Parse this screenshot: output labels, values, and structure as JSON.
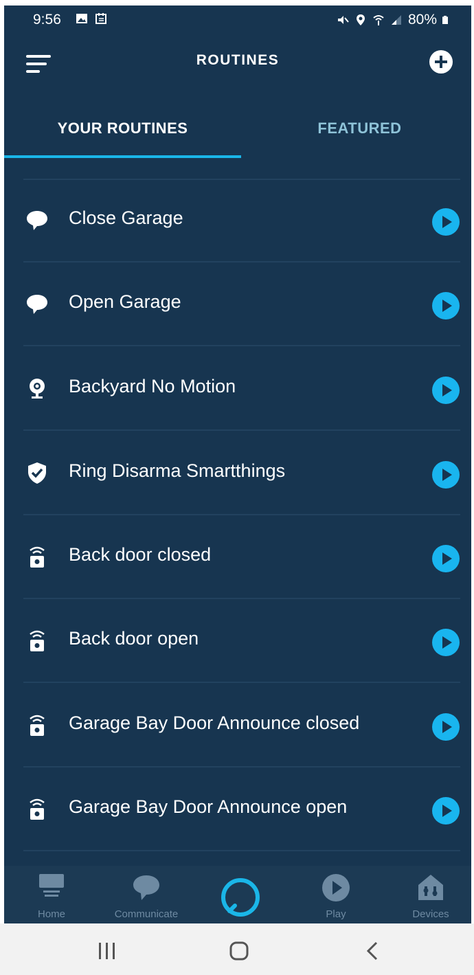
{
  "status_bar": {
    "time": "9:56",
    "battery": "80%"
  },
  "header": {
    "title": "ROUTINES"
  },
  "tabs": [
    {
      "label": "YOUR ROUTINES",
      "active": true
    },
    {
      "label": "FEATURED",
      "active": false
    }
  ],
  "routines": [
    {
      "label": "Close Garage",
      "icon": "speech-bubble-icon"
    },
    {
      "label": "Open Garage",
      "icon": "speech-bubble-icon"
    },
    {
      "label": "Backyard No Motion",
      "icon": "camera-icon"
    },
    {
      "label": "Ring Disarma Smartthings",
      "icon": "shield-check-icon"
    },
    {
      "label": "Back door closed",
      "icon": "contact-sensor-icon"
    },
    {
      "label": "Back door open",
      "icon": "contact-sensor-icon"
    },
    {
      "label": "Garage Bay Door Announce closed",
      "icon": "contact-sensor-icon"
    },
    {
      "label": "Garage Bay Door Announce open",
      "icon": "contact-sensor-icon"
    }
  ],
  "bottom_nav": {
    "home": "Home",
    "communicate": "Communicate",
    "play": "Play",
    "devices": "Devices"
  },
  "colors": {
    "background": "#173550",
    "accent": "#1ab6e8",
    "play": "#19b5ef",
    "inactive_nav": "#6e8aa2"
  }
}
